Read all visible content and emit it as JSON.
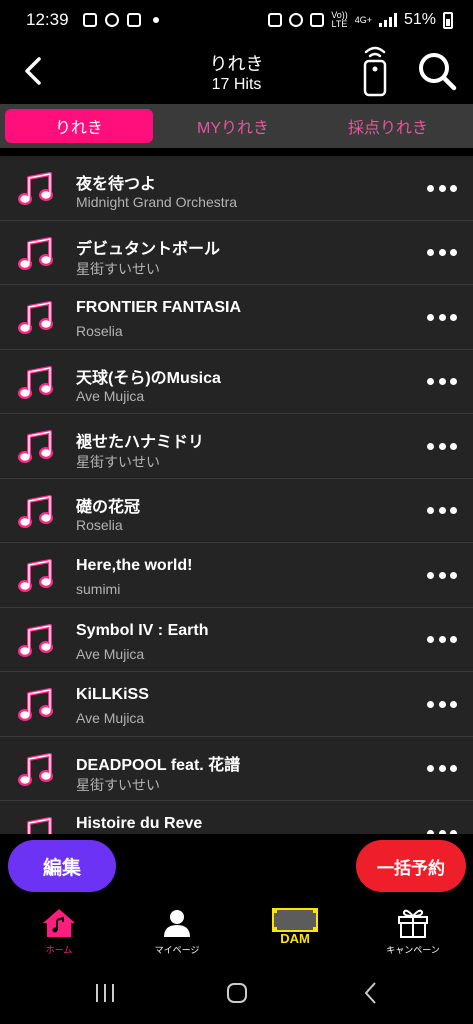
{
  "status_bar": {
    "time": "12:39",
    "net_top": "Vo))",
    "net_bottom": "LTE",
    "net_type": "4G+",
    "battery": "51%"
  },
  "header": {
    "title": "りれき",
    "hits": "17 Hits"
  },
  "tabs": [
    {
      "label": "りれき",
      "active": true
    },
    {
      "label": "MYりれき",
      "active": false
    },
    {
      "label": "採点りれき",
      "active": false
    }
  ],
  "songs": [
    {
      "title": "夜を待つよ",
      "artist": "Midnight Grand Orchestra"
    },
    {
      "title": "デビュタントボール",
      "artist": "星街すいせい"
    },
    {
      "title": "FRONTIER FANTASIA",
      "artist": "Roselia"
    },
    {
      "title": "天球(そら)のMusica",
      "artist": "Ave Mujica"
    },
    {
      "title": "褪せたハナミドリ",
      "artist": "星街すいせい"
    },
    {
      "title": "礎の花冠",
      "artist": "Roselia"
    },
    {
      "title": "Here,the world!",
      "artist": "sumimi"
    },
    {
      "title": "Symbol IV : Earth",
      "artist": "Ave Mujica"
    },
    {
      "title": "KiLLKiSS",
      "artist": "Ave Mujica"
    },
    {
      "title": "DEADPOOL feat. 花譜",
      "artist": "星街すいせい"
    },
    {
      "title": "Histoire du Reve",
      "artist": ""
    }
  ],
  "actions": {
    "edit_label": "編集",
    "bulk_reserve_label": "一括予約"
  },
  "bottom_nav": {
    "home": "ホーム",
    "mypage": "マイページ",
    "dam": "DAM",
    "campaign": "キャンペーン"
  },
  "colors": {
    "accent_pink": "#ff0f7b",
    "edit_purple": "#6d33f5",
    "reserve_red": "#ee1f2b",
    "dam_yellow": "#ffe500"
  }
}
